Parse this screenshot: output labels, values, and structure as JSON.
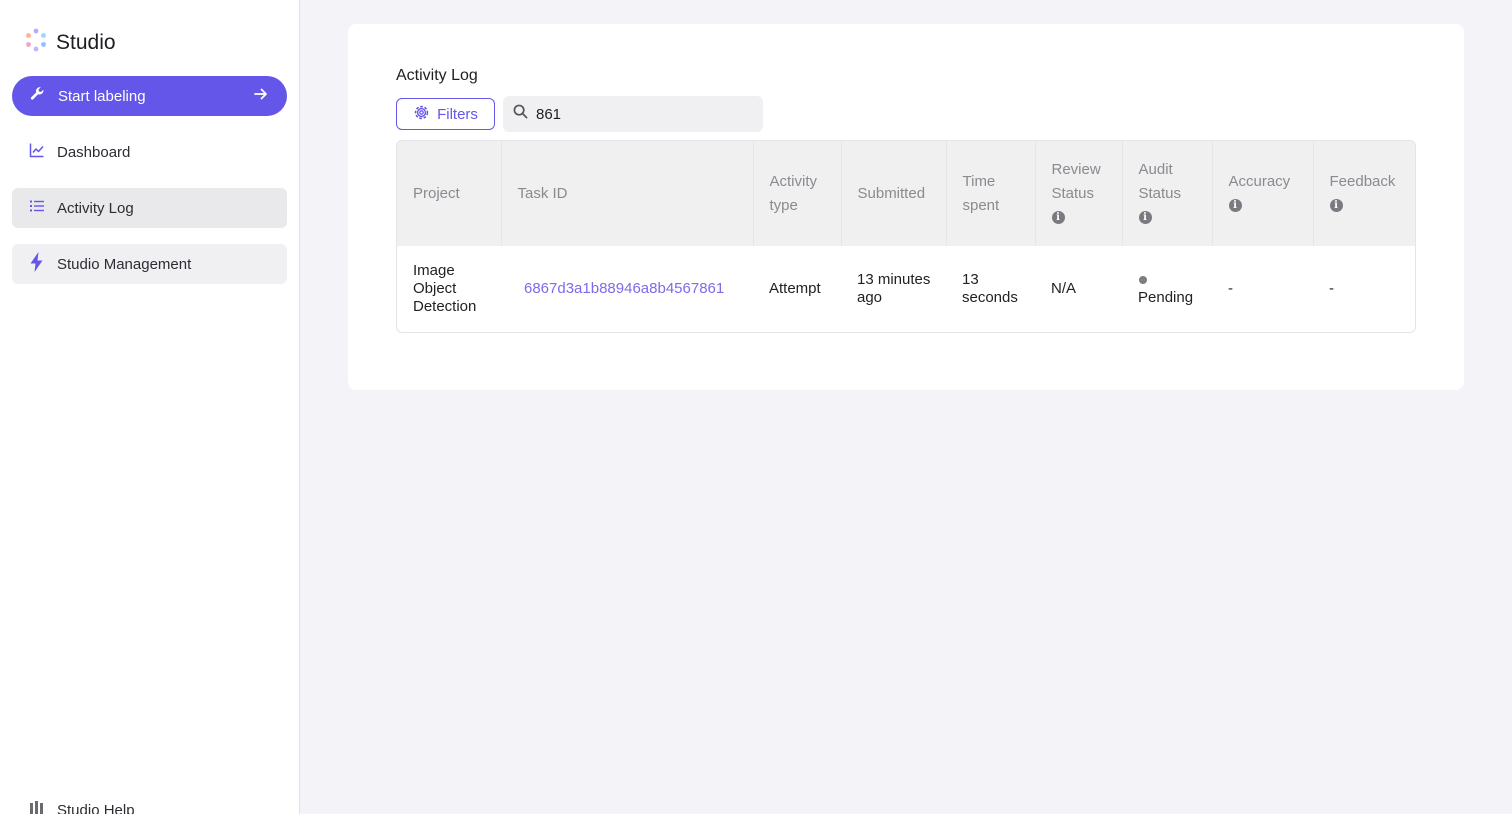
{
  "sidebar": {
    "brand": "Studio",
    "start_button": "Start labeling",
    "items": [
      {
        "label": "Dashboard"
      },
      {
        "label": "Activity Log"
      },
      {
        "label": "Studio Management"
      }
    ],
    "help": "Studio Help"
  },
  "main": {
    "title": "Activity Log",
    "filters_label": "Filters",
    "search_value": "861",
    "table": {
      "headers": {
        "project": "Project",
        "task_id": "Task ID",
        "activity_1": "Activity",
        "activity_2": "type",
        "submitted": "Submitted",
        "time_1": "Time",
        "time_2": "spent",
        "review_1": "Review",
        "review_2": "Status",
        "audit_1": "Audit",
        "audit_2": "Status",
        "accuracy": "Accuracy",
        "feedback": "Feedback"
      },
      "rows": [
        {
          "project_1": "Image",
          "project_2": "Object",
          "project_3": "Detection",
          "task_id": "6867d3a1b88946a8b4567861",
          "activity_type": "Attempt",
          "submitted_1": "13 minutes",
          "submitted_2": "ago",
          "time_1": "13",
          "time_2": "seconds",
          "review_status": "N/A",
          "audit_status": "Pending",
          "accuracy": "-",
          "feedback": "-"
        }
      ]
    }
  },
  "colors": {
    "accent": "#6456e8",
    "link": "#7b6cea",
    "page_bg": "#f4f4f8"
  },
  "icons": {
    "brand": "studio-logo-icon",
    "start": "wrench-icon",
    "arrow": "arrow-right-icon",
    "dashboard": "chart-line-icon",
    "activity": "list-icon",
    "studio": "bolt-icon",
    "help": "book-icon",
    "filters": "gear-icon",
    "search": "search-icon",
    "info": "info-icon"
  }
}
